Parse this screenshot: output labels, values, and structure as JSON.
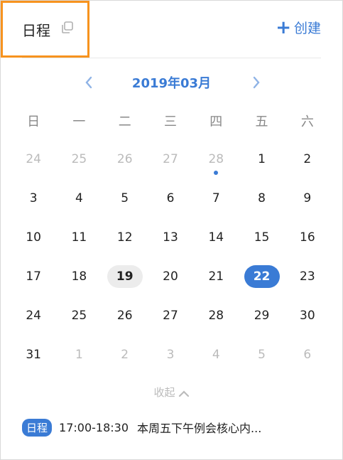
{
  "header": {
    "title": "日程",
    "create_label": "创建",
    "accent": "#3a7bd5",
    "highlight_color": "#f7931e"
  },
  "calendar": {
    "month_label": "2019年03月",
    "weekdays": [
      "日",
      "一",
      "二",
      "三",
      "四",
      "五",
      "六"
    ],
    "weeks": [
      [
        {
          "d": "24",
          "other": true
        },
        {
          "d": "25",
          "other": true
        },
        {
          "d": "26",
          "other": true
        },
        {
          "d": "27",
          "other": true
        },
        {
          "d": "28",
          "other": true,
          "event": true
        },
        {
          "d": "1"
        },
        {
          "d": "2"
        }
      ],
      [
        {
          "d": "3"
        },
        {
          "d": "4"
        },
        {
          "d": "5"
        },
        {
          "d": "6"
        },
        {
          "d": "7"
        },
        {
          "d": "8"
        },
        {
          "d": "9"
        }
      ],
      [
        {
          "d": "10"
        },
        {
          "d": "11"
        },
        {
          "d": "12"
        },
        {
          "d": "13"
        },
        {
          "d": "14"
        },
        {
          "d": "15"
        },
        {
          "d": "16"
        }
      ],
      [
        {
          "d": "17"
        },
        {
          "d": "18"
        },
        {
          "d": "19",
          "today": true
        },
        {
          "d": "20"
        },
        {
          "d": "21"
        },
        {
          "d": "22",
          "selected": true
        },
        {
          "d": "23"
        }
      ],
      [
        {
          "d": "24"
        },
        {
          "d": "25"
        },
        {
          "d": "26"
        },
        {
          "d": "27"
        },
        {
          "d": "28"
        },
        {
          "d": "29"
        },
        {
          "d": "30"
        }
      ],
      [
        {
          "d": "31"
        },
        {
          "d": "1",
          "other": true
        },
        {
          "d": "2",
          "other": true
        },
        {
          "d": "3",
          "other": true
        },
        {
          "d": "4",
          "other": true
        },
        {
          "d": "5",
          "other": true
        },
        {
          "d": "6",
          "other": true
        }
      ]
    ],
    "collapse_label": "收起"
  },
  "event": {
    "tag": "日程",
    "time": "17:00-18:30",
    "title": "本周五下午例会核心内..."
  }
}
